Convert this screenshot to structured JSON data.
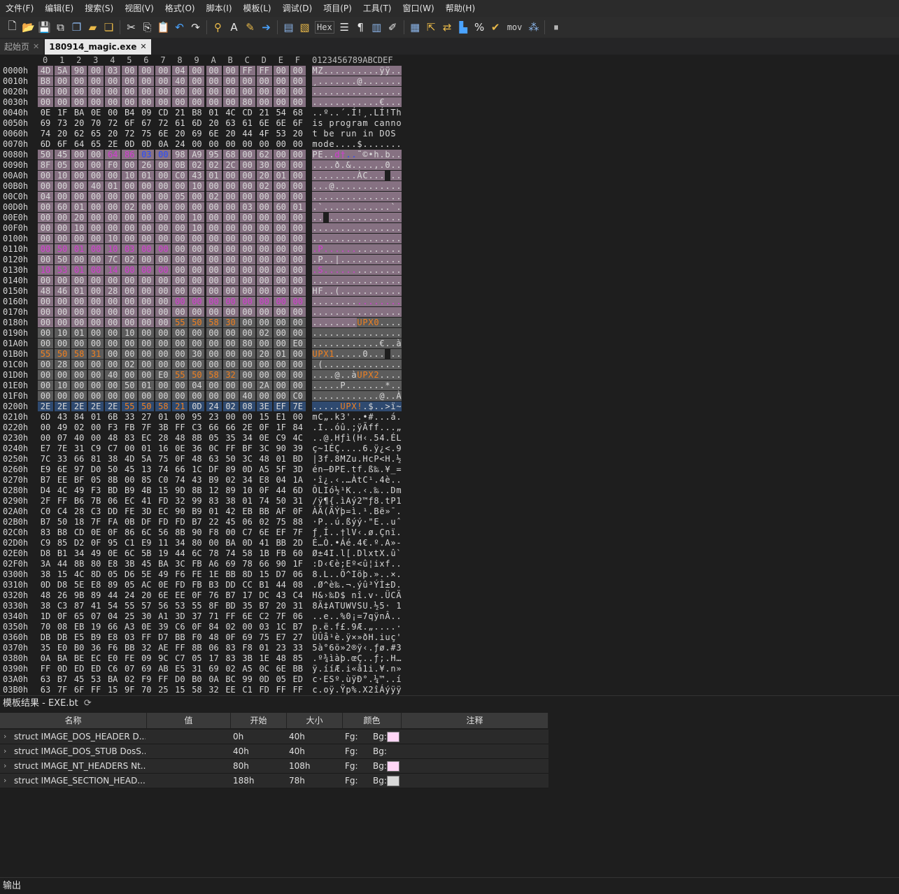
{
  "menu": [
    "文件(F)",
    "编辑(E)",
    "搜索(S)",
    "视图(V)",
    "格式(O)",
    "脚本(I)",
    "模板(L)",
    "调试(D)",
    "项目(P)",
    "工具(T)",
    "窗口(W)",
    "帮助(H)"
  ],
  "toolbar": {
    "hex_label": "Hex",
    "mov_label": "mov",
    "icons": [
      "new-file-icon",
      "open-folder-icon",
      "save-icon",
      "save-as-icon",
      "save-all-icon",
      "open-icon",
      "workspace-icon",
      "cut-icon",
      "copy-icon",
      "paste-icon",
      "undo-icon",
      "redo-icon",
      "find-icon",
      "replace-icon",
      "find-in-files-icon",
      "goto-icon",
      "hex-view-icon",
      "text-mode-icon",
      "pilcrow-icon",
      "columns-icon",
      "edit-icon",
      "calculator-icon",
      "copy-as-icon",
      "swap-icon",
      "histogram-icon",
      "percent-icon",
      "check-icon",
      "mov-icon",
      "bits-icon",
      "pause-icon"
    ]
  },
  "tabs": [
    {
      "label": "起始页",
      "active": false
    },
    {
      "label": "180914_magic.exe",
      "active": true
    }
  ],
  "hex": {
    "col_headers": [
      "0",
      "1",
      "2",
      "3",
      "4",
      "5",
      "6",
      "7",
      "8",
      "9",
      "A",
      "B",
      "C",
      "D",
      "E",
      "F"
    ],
    "ascii_header": "0123456789ABCDEF",
    "rows": [
      {
        "addr": "0000h",
        "bytes": "4D 5A 90 00 03 00 00 00 04 00 00 00 FF FF 00 00",
        "ascii": "MZ..........ÿÿ..",
        "bg": "hhhhhhhhhhhhhhhh",
        "fg": "nnnnnnnnnnnnnnnn"
      },
      {
        "addr": "0010h",
        "bytes": "B8 00 00 00 00 00 00 00 40 00 00 00 00 00 00 00",
        "ascii": "¸.......@.......",
        "bg": "hhhhhhhhhhhhhhhh",
        "fg": "nnnnnnnnnnnnnnnn"
      },
      {
        "addr": "0020h",
        "bytes": "00 00 00 00 00 00 00 00 00 00 00 00 00 00 00 00",
        "ascii": "................",
        "bg": "hhhhhhhhhhhhhhhh",
        "fg": "nnnnnnnnnnnnnnnn"
      },
      {
        "addr": "0030h",
        "bytes": "00 00 00 00 00 00 00 00 00 00 00 00 80 00 00 00",
        "ascii": "............€...",
        "bg": "hhhhhhhhhhhhhhhh",
        "fg": "nnnnnnnnnnnnnnnn"
      },
      {
        "addr": "0040h",
        "bytes": "0E 1F BA 0E 00 B4 09 CD 21 B8 01 4C CD 21 54 68",
        "ascii": "..º..´.Í!¸.LÍ!Th",
        "bg": "................",
        "fg": "nnnnnnnnnnnnnnnn"
      },
      {
        "addr": "0050h",
        "bytes": "69 73 20 70 72 6F 67 72 61 6D 20 63 61 6E 6E 6F",
        "ascii": "is program canno",
        "bg": "................",
        "fg": "nnnnnnnnnnnnnnnn"
      },
      {
        "addr": "0060h",
        "bytes": "74 20 62 65 20 72 75 6E 20 69 6E 20 44 4F 53 20",
        "ascii": "t be run in DOS ",
        "bg": "................",
        "fg": "nnnnnnnnnnnnnnnn"
      },
      {
        "addr": "0070h",
        "bytes": "6D 6F 64 65 2E 0D 0D 0A 24 00 00 00 00 00 00 00",
        "ascii": "mode....$.......",
        "bg": "................",
        "fg": "nnnnnnnnnnnnnnnn"
      },
      {
        "addr": "0080h",
        "bytes": "50 45 00 00 64 86 03 00 98 A9 95 68 00 62 00 00",
        "ascii": "PE..d†..˜©•h.b..",
        "bg": "hhhhhhhhhhhhhhhh",
        "fg": "nnnnmmbbnnnnnnnn"
      },
      {
        "addr": "0090h",
        "bytes": "8F 05 00 00 F0 00 26 00 0B 02 02 2C 00 30 00 00",
        "ascii": "....ð.&....,.0..",
        "bg": "hhhhhhhhhhhhhhhh",
        "fg": "nnnnnnnnnnnnnnnn"
      },
      {
        "addr": "00A0h",
        "bytes": "00 10 00 00 00 10 01 00 C0 43 01 00 00 20 01 00",
        "ascii": "........ÀC... ..",
        "bg": "hhhhhhhhhhhhhhhh",
        "fg": "nnnnnnnnnnnnnnnn"
      },
      {
        "addr": "00B0h",
        "bytes": "00 00 00 40 01 00 00 00 00 10 00 00 00 02 00 00",
        "ascii": "...@............",
        "bg": "hhhhhhhhhhhhhhhh",
        "fg": "nnnnnnnnnnnnnnnn"
      },
      {
        "addr": "00C0h",
        "bytes": "04 00 00 00 00 00 00 00 05 00 02 00 00 00 00 00",
        "ascii": "................",
        "bg": "hhhhhhhhhhhhhhhh",
        "fg": "nnnnnnnnnnnnnnnn"
      },
      {
        "addr": "00D0h",
        "bytes": "00 60 01 00 00 02 00 00 00 00 00 00 03 00 60 01",
        "ascii": ".`............`.",
        "bg": "hhhhhhhhhhhhhhhh",
        "fg": "nnnnnnnnnnnnnnnn"
      },
      {
        "addr": "00E0h",
        "bytes": "00 00 20 00 00 00 00 00 00 10 00 00 00 00 00 00",
        "ascii": ".. .............",
        "bg": "hhhhhhhhhhhhhhhh",
        "fg": "nnnnnnnnnnnnnnnn"
      },
      {
        "addr": "00F0h",
        "bytes": "00 00 10 00 00 00 00 00 00 10 00 00 00 00 00 00",
        "ascii": "................",
        "bg": "hhhhhhhhhhhhhhhh",
        "fg": "nnnnnnnnnnnnnnnn"
      },
      {
        "addr": "0100h",
        "bytes": "00 00 00 00 10 00 00 00 00 00 00 00 00 00 00 00",
        "ascii": "................",
        "bg": "hhhhhhhhhhhhhhhh",
        "fg": "nnnnnnnnnnnnnnnn"
      },
      {
        "addr": "0110h",
        "bytes": "00 50 01 00 10 03 00 00 00 00 00 00 00 00 00 00",
        "ascii": ".P..............",
        "bg": "hhhhhhhhhhhhhhhh",
        "fg": "mmmmmmmmnnnnnnnn"
      },
      {
        "addr": "0120h",
        "bytes": "00 50 00 00 7C 02 00 00 00 00 00 00 00 00 00 00",
        "ascii": ".P..|...........",
        "bg": "hhhhhhhhhhhhhhhh",
        "fg": "nnnnnnnnnnnnnnnn"
      },
      {
        "addr": "0130h",
        "bytes": "10 53 01 00 14 00 00 00 00 00 00 00 00 00 00 00",
        "ascii": ".S..............",
        "bg": "hhhhhhhhhhhhhhhh",
        "fg": "mmmmmmmmnnnnnnnn"
      },
      {
        "addr": "0140h",
        "bytes": "00 00 00 00 00 00 00 00 00 00 00 00 00 00 00 00",
        "ascii": "................",
        "bg": "hhhhhhhhhhhhhhhh",
        "fg": "nnnnnnnnnnnnnnnn"
      },
      {
        "addr": "0150h",
        "bytes": "48 46 01 00 28 00 00 00 00 00 00 00 00 00 00 00",
        "ascii": "HF..(...........",
        "bg": "hhhhhhhhhhhhhhhh",
        "fg": "nnnnnnnnnnnnnnnn"
      },
      {
        "addr": "0160h",
        "bytes": "00 00 00 00 00 00 00 00 00 00 00 00 00 00 00 00",
        "ascii": "................",
        "bg": "hhhhhhhhhhhhhhhh",
        "fg": "nnnnnnnnmmmmmmmm"
      },
      {
        "addr": "0170h",
        "bytes": "00 00 00 00 00 00 00 00 00 00 00 00 00 00 00 00",
        "ascii": "................",
        "bg": "hhhhhhhhhhhhhhhh",
        "fg": "nnnnnnnnnnnnnnnn"
      },
      {
        "addr": "0180h",
        "bytes": "00 00 00 00 00 00 00 00 55 50 58 30 00 00 00 00",
        "ascii": "........UPX0....",
        "bg": "hhhhhhhhgggggggg",
        "fg": "nnnnnnnnoooonnnn"
      },
      {
        "addr": "0190h",
        "bytes": "00 10 01 00 00 10 00 00 00 00 00 00 00 02 00 00",
        "ascii": "................",
        "bg": "gggggggggggggggg",
        "fg": "nnnnnnnnnnnnnnnn"
      },
      {
        "addr": "01A0h",
        "bytes": "00 00 00 00 00 00 00 00 00 00 00 00 80 00 00 E0",
        "ascii": "............€..à",
        "bg": "gggggggggggggggg",
        "fg": "nnnnnnnnnnnnnnnn"
      },
      {
        "addr": "01B0h",
        "bytes": "55 50 58 31 00 00 00 00 00 30 00 00 00 20 01 00",
        "ascii": "UPX1.....0... ..",
        "bg": "gggggggggggggggg",
        "fg": "oooonnnnnnnnnnnn"
      },
      {
        "addr": "01C0h",
        "bytes": "00 28 00 00 00 02 00 00 00 00 00 00 00 00 00 00",
        "ascii": ".(..............",
        "bg": "gggggggggggggggg",
        "fg": "nnnnnnnnnnnnnnnn"
      },
      {
        "addr": "01D0h",
        "bytes": "00 00 00 00 40 00 00 E0 55 50 58 32 00 00 00 00",
        "ascii": "....@..àUPX2....",
        "bg": "gggggggggggggggg",
        "fg": "nnnnnnnnoooonnnn"
      },
      {
        "addr": "01E0h",
        "bytes": "00 10 00 00 00 50 01 00 00 04 00 00 00 2A 00 00",
        "ascii": ".....P.......*..",
        "bg": "gggggggggggggggg",
        "fg": "nnnnnnnnnnnnnnnn"
      },
      {
        "addr": "01F0h",
        "bytes": "00 00 00 00 00 00 00 00 00 00 00 00 40 00 00 C0",
        "ascii": "............@..À",
        "bg": "gggggggggggggggg",
        "fg": "nnnnnnnnnnnnnnnn"
      },
      {
        "addr": "0200h",
        "bytes": "2E 2E 2E 2E 2E 55 50 58 21 0D 24 02 08 3E EF 7E",
        "ascii": ".....UPX!.$..>ï~",
        "bg": "ssssssssssssssss",
        "fg": "nnnnnoooonnnnnnn"
      },
      {
        "addr": "0210h",
        "bytes": "6D 43 84 01 6B 33 27 01 00 95 23 00 00 15 E1 00",
        "ascii": "mC„.k3'..•#...á.",
        "bg": "................",
        "fg": "nnnnnnnnnnnnnnnn"
      },
      {
        "addr": "0220h",
        "bytes": "00 49 02 00 F3 FB 7F 3B FF C3 66 66 2E 0F 1F 84",
        "ascii": ".I..óû.;ÿÃff...„",
        "bg": "................",
        "fg": "nnnnnnnnnnnnnnnn"
      },
      {
        "addr": "0230h",
        "bytes": "00 07 40 00 48 83 EC 28 48 8B 05 35 34 0E C9 4C",
        "ascii": "..@.Hƒì(H‹.54.ÉL",
        "bg": "................",
        "fg": "nnnnnnnnnnnnnnnn"
      },
      {
        "addr": "0240h",
        "bytes": "E7 7E 31 C9 C7 00 01 16 0E 36 0C FF BF 3C 90 39",
        "ascii": "ç~1ÉÇ....6.ÿ¿<.9",
        "bg": "................",
        "fg": "nnnnnnnnnnnnnnnn"
      },
      {
        "addr": "0250h",
        "bytes": "7C 33 66 81 38 4D 5A 75 0F 48 63 50 3C 48 01 BD",
        "ascii": "|3f.8MZu.HcP<H.½",
        "bg": "................",
        "fg": "nnnnnnnnnnnnnnnn"
      },
      {
        "addr": "0260h",
        "bytes": "E9 6E 97 D0 50 45 13 74 66 1C DF 89 0D A5 5F 3D",
        "ascii": "én—ÐPE.tf.ß‰.¥_=",
        "bg": "................",
        "fg": "nnnnnnnnnnnnnnnn"
      },
      {
        "addr": "0270h",
        "bytes": "B7 EE BF 05 8B 00 85 C0 74 43 B9 02 34 E8 04 1A",
        "ascii": "·î¿.‹.…ÀtC¹.4è..",
        "bg": "................",
        "fg": "nnnnnnnnnnnnnnnn"
      },
      {
        "addr": "0280h",
        "bytes": "D4 4C 49 F3 BD B9 4B 15 9D 8B 12 89 10 0F 44 6D",
        "ascii": "ÔLIó½¹K..‹.‰..Dm",
        "bg": "................",
        "fg": "nnnnnnnnnnnnnnnn"
      },
      {
        "addr": "0290h",
        "bytes": "2F FF B6 7B 06 EC 41 FD 32 99 83 38 01 74 50 31",
        "ascii": "/ÿ¶{.ìAý2™ƒ8.tP1",
        "bg": "................",
        "fg": "nnnnnnnnnnnnnnnn"
      },
      {
        "addr": "02A0h",
        "bytes": "C0 C4 28 C3 DD FE 3D EC 90 B9 01 42 EB BB AF 0F",
        "ascii": "ÀÄ(ÃÝþ=ì.¹.Bë»¯.",
        "bg": "................",
        "fg": "nnnnnnnnnnnnnnnn"
      },
      {
        "addr": "02B0h",
        "bytes": "B7 50 18 7F FA 0B DF FD FD B7 22 45 06 02 75 88",
        "ascii": "·P..ú.ßýý·\"E..uˆ",
        "bg": "................",
        "fg": "nnnnnnnnnnnnnnnn"
      },
      {
        "addr": "02C0h",
        "bytes": "83 B8 CD 0E 0F 86 6C 56 8B 90 F8 00 C7 6E EF 7F",
        "ascii": "ƒ¸Í..†lV‹.ø.Çnï.",
        "bg": "................",
        "fg": "nnnnnnnnnnnnnnnn"
      },
      {
        "addr": "02D0h",
        "bytes": "C9 85 D2 0F 95 C1 E9 11 34 80 00 BA 0D 41 BB 2D",
        "ascii": "É…Ò.•Áé.4€.º.A»-",
        "bg": "................",
        "fg": "nnnnnnnnnnnnnnnn"
      },
      {
        "addr": "02E0h",
        "bytes": "D8 B1 34 49 0E 6C 5B 19 44 6C 78 74 58 1B FB 60",
        "ascii": "Ø±4I.l[.DlxtX.û`",
        "bg": "................",
        "fg": "nnnnnnnnnnnnnnnn"
      },
      {
        "addr": "02F0h",
        "bytes": "3A 44 8B 80 E8 3B 45 BA 3C FB A6 69 78 66 90 1F",
        "ascii": ":D‹€è;Eº<û¦ixf..",
        "bg": "................",
        "fg": "nnnnnnnnnnnnnnnn"
      },
      {
        "addr": "0300h",
        "bytes": "38 15 4C 8D 05 D6 5E 49 F6 FE 1E BB 8D 15 D7 06",
        "ascii": "8.L..Ö^Iöþ.»..×.",
        "bg": "................",
        "fg": "nnnnnnnnnnnnnnnn"
      },
      {
        "addr": "0310h",
        "bytes": "0D D8 5E E8 89 05 AC 0E FD FB B3 DD CC B1 44 08",
        "ascii": ".Ø^è‰.¬.ýû³ÝÌ±D.",
        "bg": "................",
        "fg": "nnnnnnnnnnnnnnnn"
      },
      {
        "addr": "0320h",
        "bytes": "48 26 9B 89 44 24 20 6E EE 0F 76 B7 17 DC 43 C4",
        "ascii": "H&›‰D$ nî.v·.ÜCÄ",
        "bg": "................",
        "fg": "nnnnnnnnnnnnnnnn"
      },
      {
        "addr": "0330h",
        "bytes": "38 C3 87 41 54 55 57 56 53 55 8F BD 35 B7 20 31",
        "ascii": "8Ã‡ATUWVSU.½5· 1",
        "bg": "................",
        "fg": "nnnnnnnnnnnnnnnn"
      },
      {
        "addr": "0340h",
        "bytes": "1D 0F 65 07 04 25 30 A1 3D 37 71 FF 6E C2 7F 06",
        "ascii": "..e..%0¡=7qÿnÂ..",
        "bg": "................",
        "fg": "nnnnnnnnnnnnnnnn"
      },
      {
        "addr": "0350h",
        "bytes": "70 08 EB 19 66 A3 0E 39 C6 0F 84 02 00 03 1C B7",
        "ascii": "p.ë.f£.9Æ.„....·",
        "bg": "................",
        "fg": "nnnnnnnnnnnnnnnn"
      },
      {
        "addr": "0360h",
        "bytes": "DB DB E5 B9 E8 03 FF D7 BB F0 48 0F 69 75 E7 27",
        "ascii": "ÛÛå¹è.ÿ×»ðH.iuç'",
        "bg": "................",
        "fg": "nnnnnnnnnnnnnnnn"
      },
      {
        "addr": "0370h",
        "bytes": "35 E0 B0 36 F6 BB 32 AE FF 8B 06 83 F8 01 23 33",
        "ascii": "5à°6ö»2®ÿ‹.ƒø.#3",
        "bg": "................",
        "fg": "nnnnnnnnnnnnnnnn"
      },
      {
        "addr": "0380h",
        "bytes": "0A BA BE EC E0 FE 09 9C C7 05 17 83 3B 1E 48 85",
        "ascii": ".º¾ìàþ.œÇ..ƒ;.H…",
        "bg": "................",
        "fg": "nnnnnnnnnnnnnnnn"
      },
      {
        "addr": "0390h",
        "bytes": "FF 0D ED ED C6 07 69 AB E5 31 69 02 A5 0C 6E BB",
        "ascii": "ÿ.ííÆ.i«å1i.¥.n»",
        "bg": "................",
        "fg": "nnnnnnnnnnnnnnnn"
      },
      {
        "addr": "03A0h",
        "bytes": "63 B7 45 53 BA 02 F9 FF D0 B0 0A BC 99 0D 05 ED",
        "ascii": "c·ESº.ùÿÐ°.¼™..í",
        "bg": "................",
        "fg": "nnnnnnnnnnnnnnnn"
      },
      {
        "addr": "03B0h",
        "bytes": "63 7F 6F FF 15 9F 70 25 15 58 32 EE C1 FD FF FF",
        "ascii": "c.oÿ.Ÿp%.X2îÁýÿÿ",
        "bg": "................",
        "fg": "nnnnnnnnnnnnnnnn"
      }
    ]
  },
  "template": {
    "title": "模板结果 - EXE.bt",
    "headers": [
      "名称",
      "值",
      "开始",
      "大小",
      "颜色",
      "注释"
    ],
    "rows": [
      {
        "name": "struct IMAGE_DOS_HEADER D...",
        "value": "",
        "start": "0h",
        "size": "40h",
        "fg_label": "Fg:",
        "bg_label": "Bg:",
        "bg_color": "#ffd6f6"
      },
      {
        "name": "struct IMAGE_DOS_STUB DosS...",
        "value": "",
        "start": "40h",
        "size": "40h",
        "fg_label": "Fg:",
        "bg_label": "Bg:",
        "bg_color": ""
      },
      {
        "name": "struct IMAGE_NT_HEADERS Nt...",
        "value": "",
        "start": "80h",
        "size": "108h",
        "fg_label": "Fg:",
        "bg_label": "Bg:",
        "bg_color": "#ffd6f6"
      },
      {
        "name": "struct IMAGE_SECTION_HEAD...",
        "value": "",
        "start": "188h",
        "size": "78h",
        "fg_label": "Fg:",
        "bg_label": "Bg:",
        "bg_color": "#d8d8d8"
      }
    ]
  },
  "output_label": "输出",
  "colors": {
    "header_bg": "#867182",
    "grey_bg": "#5c5c5c",
    "selection_bg": "#2f4a70",
    "magenta": "#d43cd4",
    "orange": "#f08020",
    "blue": "#2a4cff"
  }
}
